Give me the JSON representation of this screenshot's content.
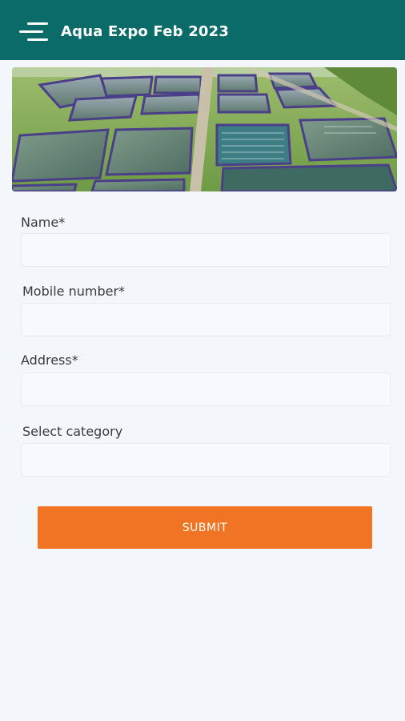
{
  "app_bar": {
    "title": "Aqua Expo Feb 2023",
    "menu_icon": "hamburger-menu-icon",
    "background_color": "#0b6b68"
  },
  "hero_image": {
    "description_icon": "aquaculture-ponds-photo"
  },
  "form": {
    "fields": [
      {
        "label": "Name*",
        "value": "",
        "placeholder": ""
      },
      {
        "label": "Mobile number*",
        "value": "",
        "placeholder": ""
      },
      {
        "label": "Address*",
        "value": "",
        "placeholder": ""
      },
      {
        "label": "Select category",
        "value": "",
        "placeholder": ""
      }
    ],
    "submit_label": "SUBMIT",
    "submit_color": "#f07424"
  }
}
